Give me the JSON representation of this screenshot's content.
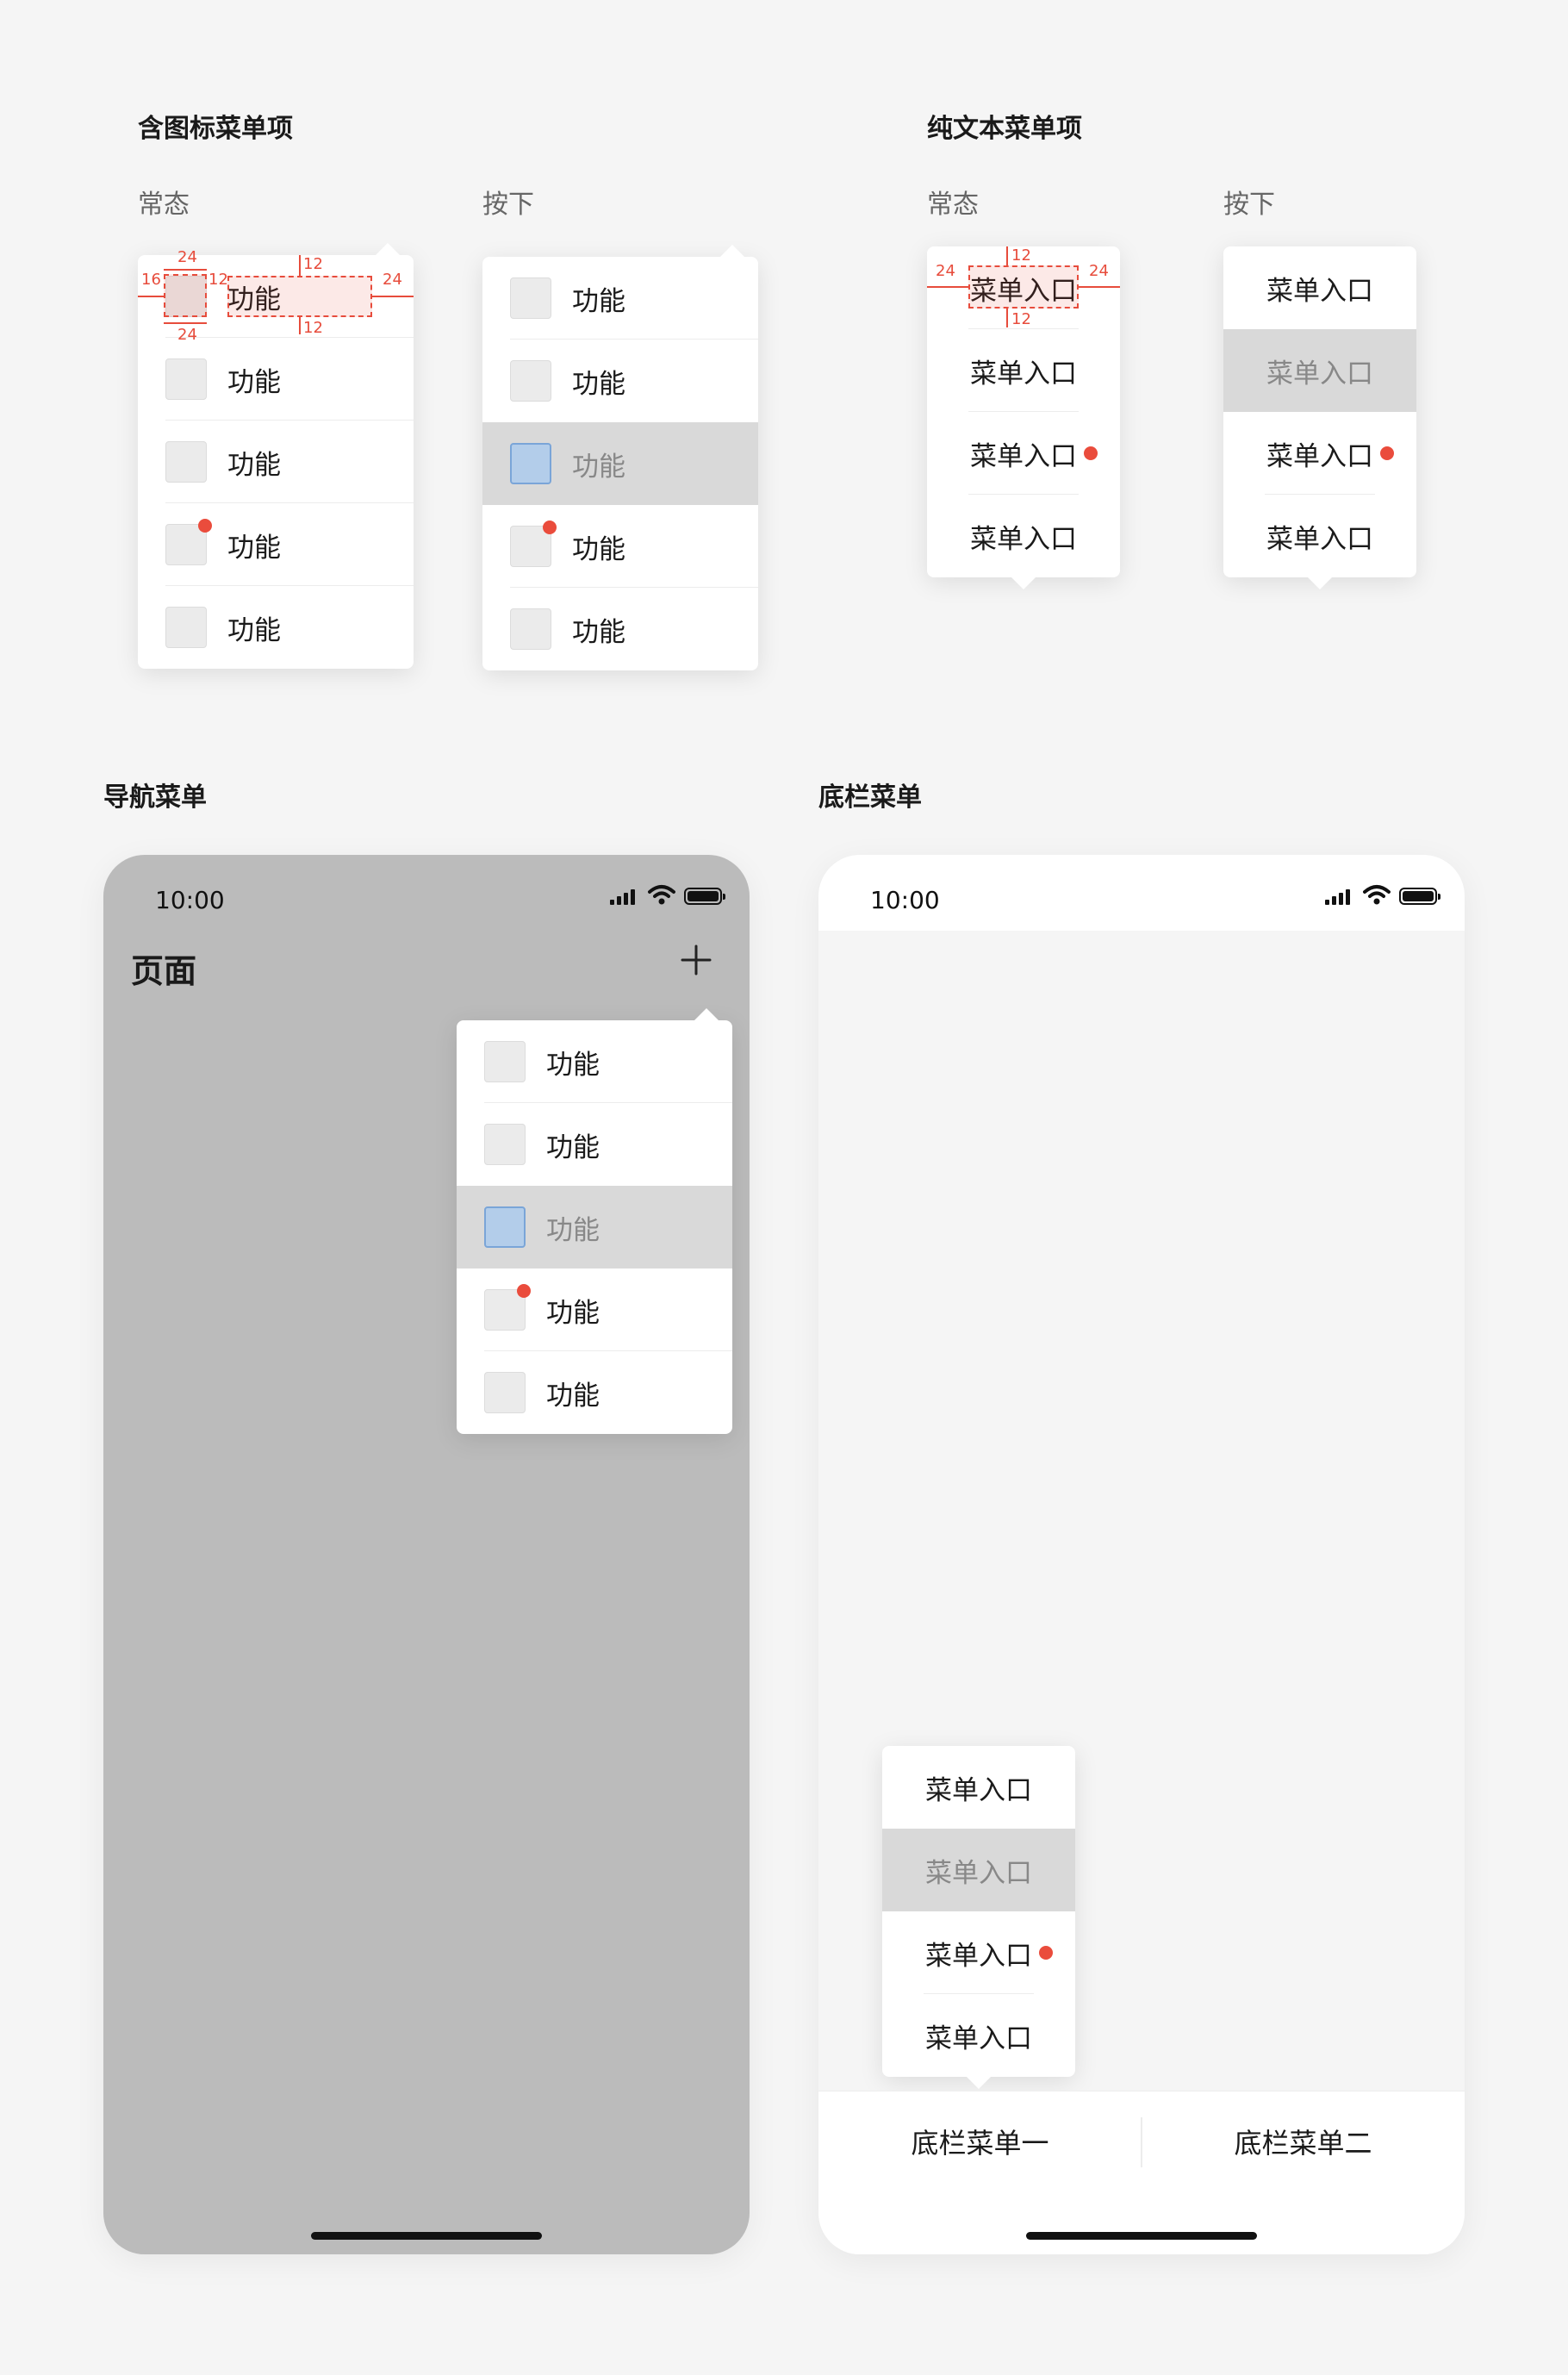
{
  "icon_section": {
    "title": "含图标菜单项",
    "normal_label": "常态",
    "pressed_label": "按下",
    "item_label": "功能",
    "spec": {
      "a": "24",
      "b": "16",
      "c": "12",
      "d": "12",
      "e": "24",
      "f": "12",
      "g": "24"
    }
  },
  "text_section": {
    "title": "纯文本菜单项",
    "normal_label": "常态",
    "pressed_label": "按下",
    "item_label": "菜单入口",
    "spec": {
      "top": "12",
      "left": "24",
      "right": "24",
      "bottom": "12"
    }
  },
  "nav_section": {
    "title": "导航菜单",
    "time": "10:00",
    "page_title": "页面",
    "add_icon": "plus-icon",
    "item_label": "功能"
  },
  "bottom_section": {
    "title": "底栏菜单",
    "time": "10:00",
    "item_label": "菜单入口",
    "tab1": "底栏菜单一",
    "tab2": "底栏菜单二"
  },
  "colors": {
    "badge": "#ea4c3c",
    "pressed_bg": "#d9d9d9",
    "selected_icon": "#b3cdea",
    "overlay": "#bbbbbb"
  }
}
